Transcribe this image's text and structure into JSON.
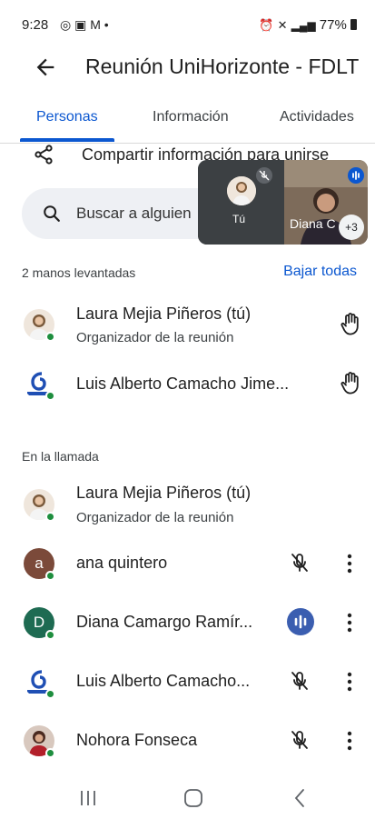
{
  "status_bar": {
    "time": "9:28",
    "battery": "77%"
  },
  "header": {
    "title": "Reunión UniHorizonte - FDLT"
  },
  "tabs": [
    {
      "label": "Personas",
      "active": true
    },
    {
      "label": "Información",
      "active": false
    },
    {
      "label": "Actividades",
      "active": false
    }
  ],
  "share": {
    "label": "Compartir información para unirse"
  },
  "search": {
    "placeholder": "Buscar a alguien"
  },
  "pip": {
    "self_label": "Tú",
    "other_label": "Diana C",
    "more_count": "+3"
  },
  "raised_hands": {
    "heading": "2 manos levantadas",
    "action": "Bajar todas",
    "people": [
      {
        "name": "Laura Mejia Piñeros (tú)",
        "role": "Organizador de la reunión"
      },
      {
        "name": "Luis Alberto Camacho Jime..."
      }
    ]
  },
  "in_call": {
    "heading": "En la llamada",
    "people": [
      {
        "name": "Laura Mejia Piñeros (tú)",
        "role": "Organizador de la reunión"
      },
      {
        "name": "ana quintero",
        "initial": "a",
        "color": "#7b4a3a"
      },
      {
        "name": "Diana Camargo Ramír...",
        "initial": "D",
        "color": "#1e6b52"
      },
      {
        "name": "Luis Alberto Camacho..."
      },
      {
        "name": "Nohora Fonseca"
      }
    ]
  },
  "colors": {
    "accent": "#0b57d0",
    "online": "#1e8e3e"
  },
  "icons": [
    "whatsapp-icon",
    "gallery-icon",
    "gmail-icon",
    "alarm-icon",
    "mute-icon",
    "signal-icon",
    "battery-icon",
    "back-arrow-icon",
    "share-icon",
    "search-icon",
    "raised-hand-icon",
    "mic-off-icon",
    "speaking-icon",
    "more-vert-icon",
    "recents-icon",
    "home-icon",
    "back-nav-icon"
  ]
}
